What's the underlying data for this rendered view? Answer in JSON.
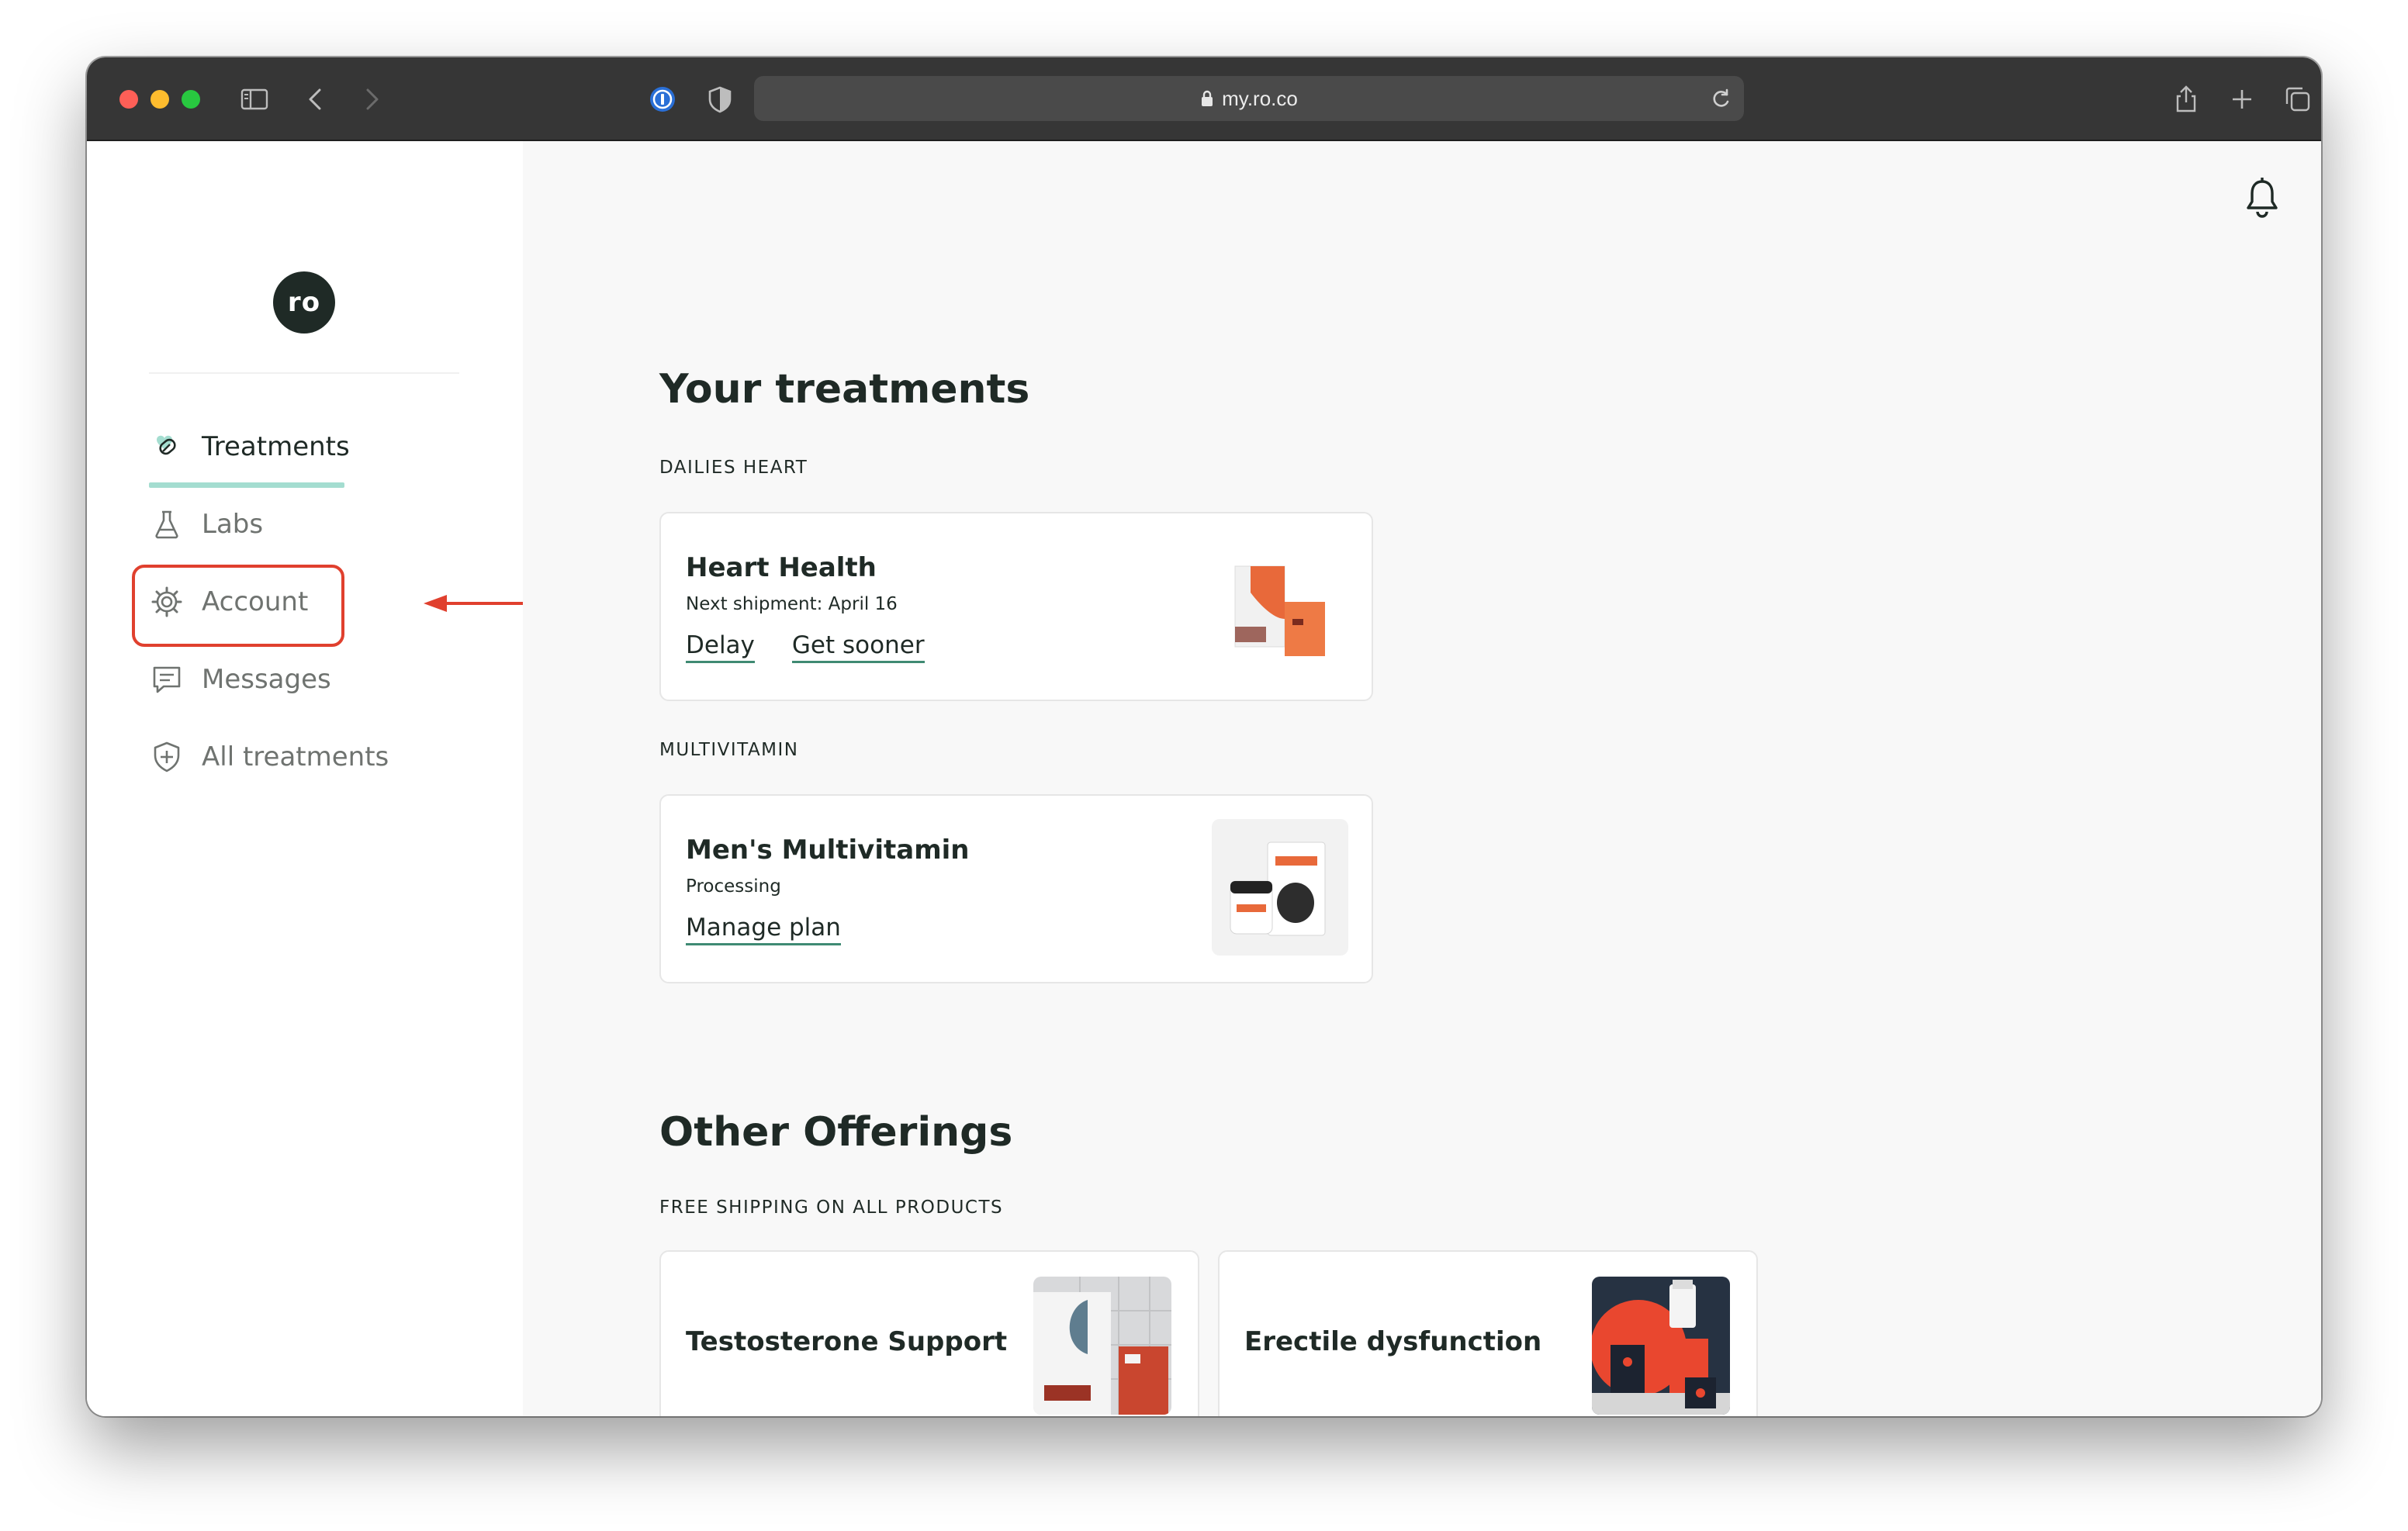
{
  "browser": {
    "url": "my.ro.co",
    "icons": [
      "sidebar-toggle-icon",
      "back-icon",
      "forward-icon",
      "password-manager-icon",
      "shield-icon",
      "lock-icon",
      "reload-icon",
      "share-icon",
      "new-tab-icon",
      "tabs-overview-icon"
    ]
  },
  "sidebar": {
    "logo_text": "ro",
    "items": [
      {
        "label": "Treatments",
        "icon": "pill-heart-icon",
        "active": true
      },
      {
        "label": "Labs",
        "icon": "flask-icon",
        "active": false
      },
      {
        "label": "Account",
        "icon": "gear-icon",
        "active": false
      },
      {
        "label": "Messages",
        "icon": "message-icon",
        "active": false
      },
      {
        "label": "All treatments",
        "icon": "plus-shield-icon",
        "active": false
      }
    ]
  },
  "annotation": {
    "highlight_color": "#e0402e"
  },
  "main": {
    "bell_icon": "bell-icon",
    "treatments": {
      "heading": "Your treatments",
      "groups": [
        {
          "eyebrow": "DAILIES HEART",
          "title": "Heart Health",
          "status": "Next shipment: April 16",
          "links": [
            "Delay",
            "Get sooner"
          ]
        },
        {
          "eyebrow": "MULTIVITAMIN",
          "title": "Men's Multivitamin",
          "status": "Processing",
          "links": [
            "Manage plan"
          ]
        }
      ]
    },
    "offerings": {
      "heading": "Other Offerings",
      "eyebrow": "FREE SHIPPING ON ALL PRODUCTS",
      "cards": [
        {
          "title": "Testosterone Support"
        },
        {
          "title": "Erectile dysfunction"
        }
      ]
    }
  },
  "colors": {
    "accent": "#a4ddd0",
    "link_underline": "#3f8a73",
    "text_dark": "#1f2a26",
    "orange_product": "#e8693a"
  }
}
